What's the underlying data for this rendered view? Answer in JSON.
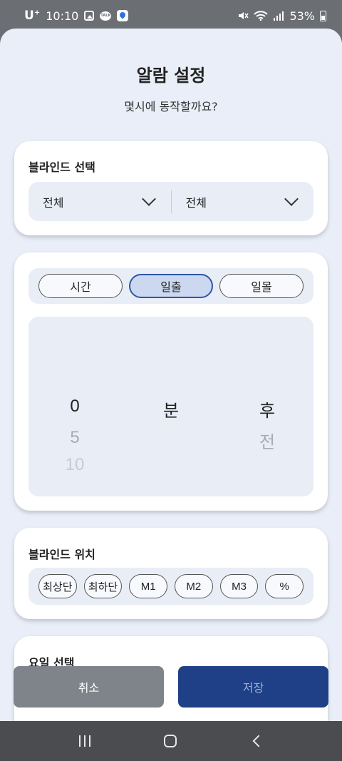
{
  "status_bar": {
    "carrier": "U",
    "carrier_sup": "+",
    "time": "10:10",
    "talk_icon_text": "TALK",
    "battery": "53%",
    "icons": [
      "gallery-icon",
      "talk-icon",
      "map-icon",
      "mute-icon",
      "wifi-icon",
      "signal-icon",
      "battery-icon"
    ]
  },
  "sheet": {
    "title": "알람 설정",
    "subtitle": "몇시에 동작할까요?"
  },
  "blind_select": {
    "label": "블라인드 선택",
    "left_value": "전체",
    "right_value": "전체"
  },
  "time_card": {
    "segments": [
      {
        "label": "시간",
        "active": false
      },
      {
        "label": "일출",
        "active": true
      },
      {
        "label": "일몰",
        "active": false
      }
    ],
    "picker": {
      "col1": {
        "selected": "0",
        "next1": "5",
        "next2": "10"
      },
      "col2": {
        "selected": "분"
      },
      "col3": {
        "selected": "후",
        "next1": "전"
      }
    }
  },
  "blind_position": {
    "label": "블라인드 위치",
    "options": [
      "최상단",
      "최하단",
      "M1",
      "M2",
      "M3",
      "%"
    ]
  },
  "day_select": {
    "label": "요일 선택"
  },
  "actions": {
    "cancel": "취소",
    "save": "저장"
  },
  "colors": {
    "accent": "#2e56a6",
    "save_button": "#1f3f86",
    "cancel_button": "#7f848b",
    "sheet_background": "#e9eef8"
  }
}
